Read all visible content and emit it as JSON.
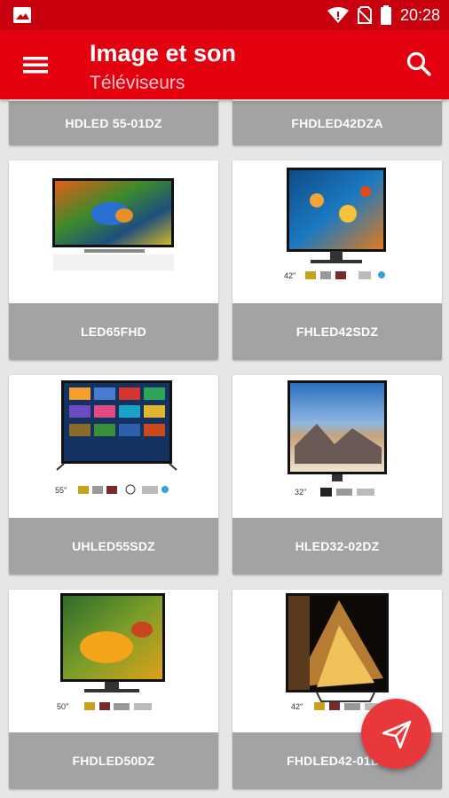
{
  "status_bar": {
    "time": "20:28"
  },
  "app_bar": {
    "title": "Image et son",
    "subtitle": "Téléviseurs"
  },
  "products_top": [
    {
      "name": "HDLED 55-01DZ"
    },
    {
      "name": "FHDLED42DZA"
    }
  ],
  "products": [
    {
      "name": "LED65FHD",
      "size": ""
    },
    {
      "name": "FHLED42SDZ",
      "size": "42\""
    },
    {
      "name": "UHLED55SDZ",
      "size": "55\""
    },
    {
      "name": "HLED32-02DZ",
      "size": "32\""
    },
    {
      "name": "FHDLED50DZ",
      "size": "50\""
    },
    {
      "name": "FHDLED42-01DZ",
      "size": "42\""
    }
  ],
  "colors": {
    "primary": "#e3000f",
    "status": "#c9000d",
    "label_bg": "#a3a3a3",
    "fab": "#e8383b"
  },
  "icons": {
    "menu": "hamburger-icon",
    "search": "search-icon",
    "fab": "send-icon"
  }
}
